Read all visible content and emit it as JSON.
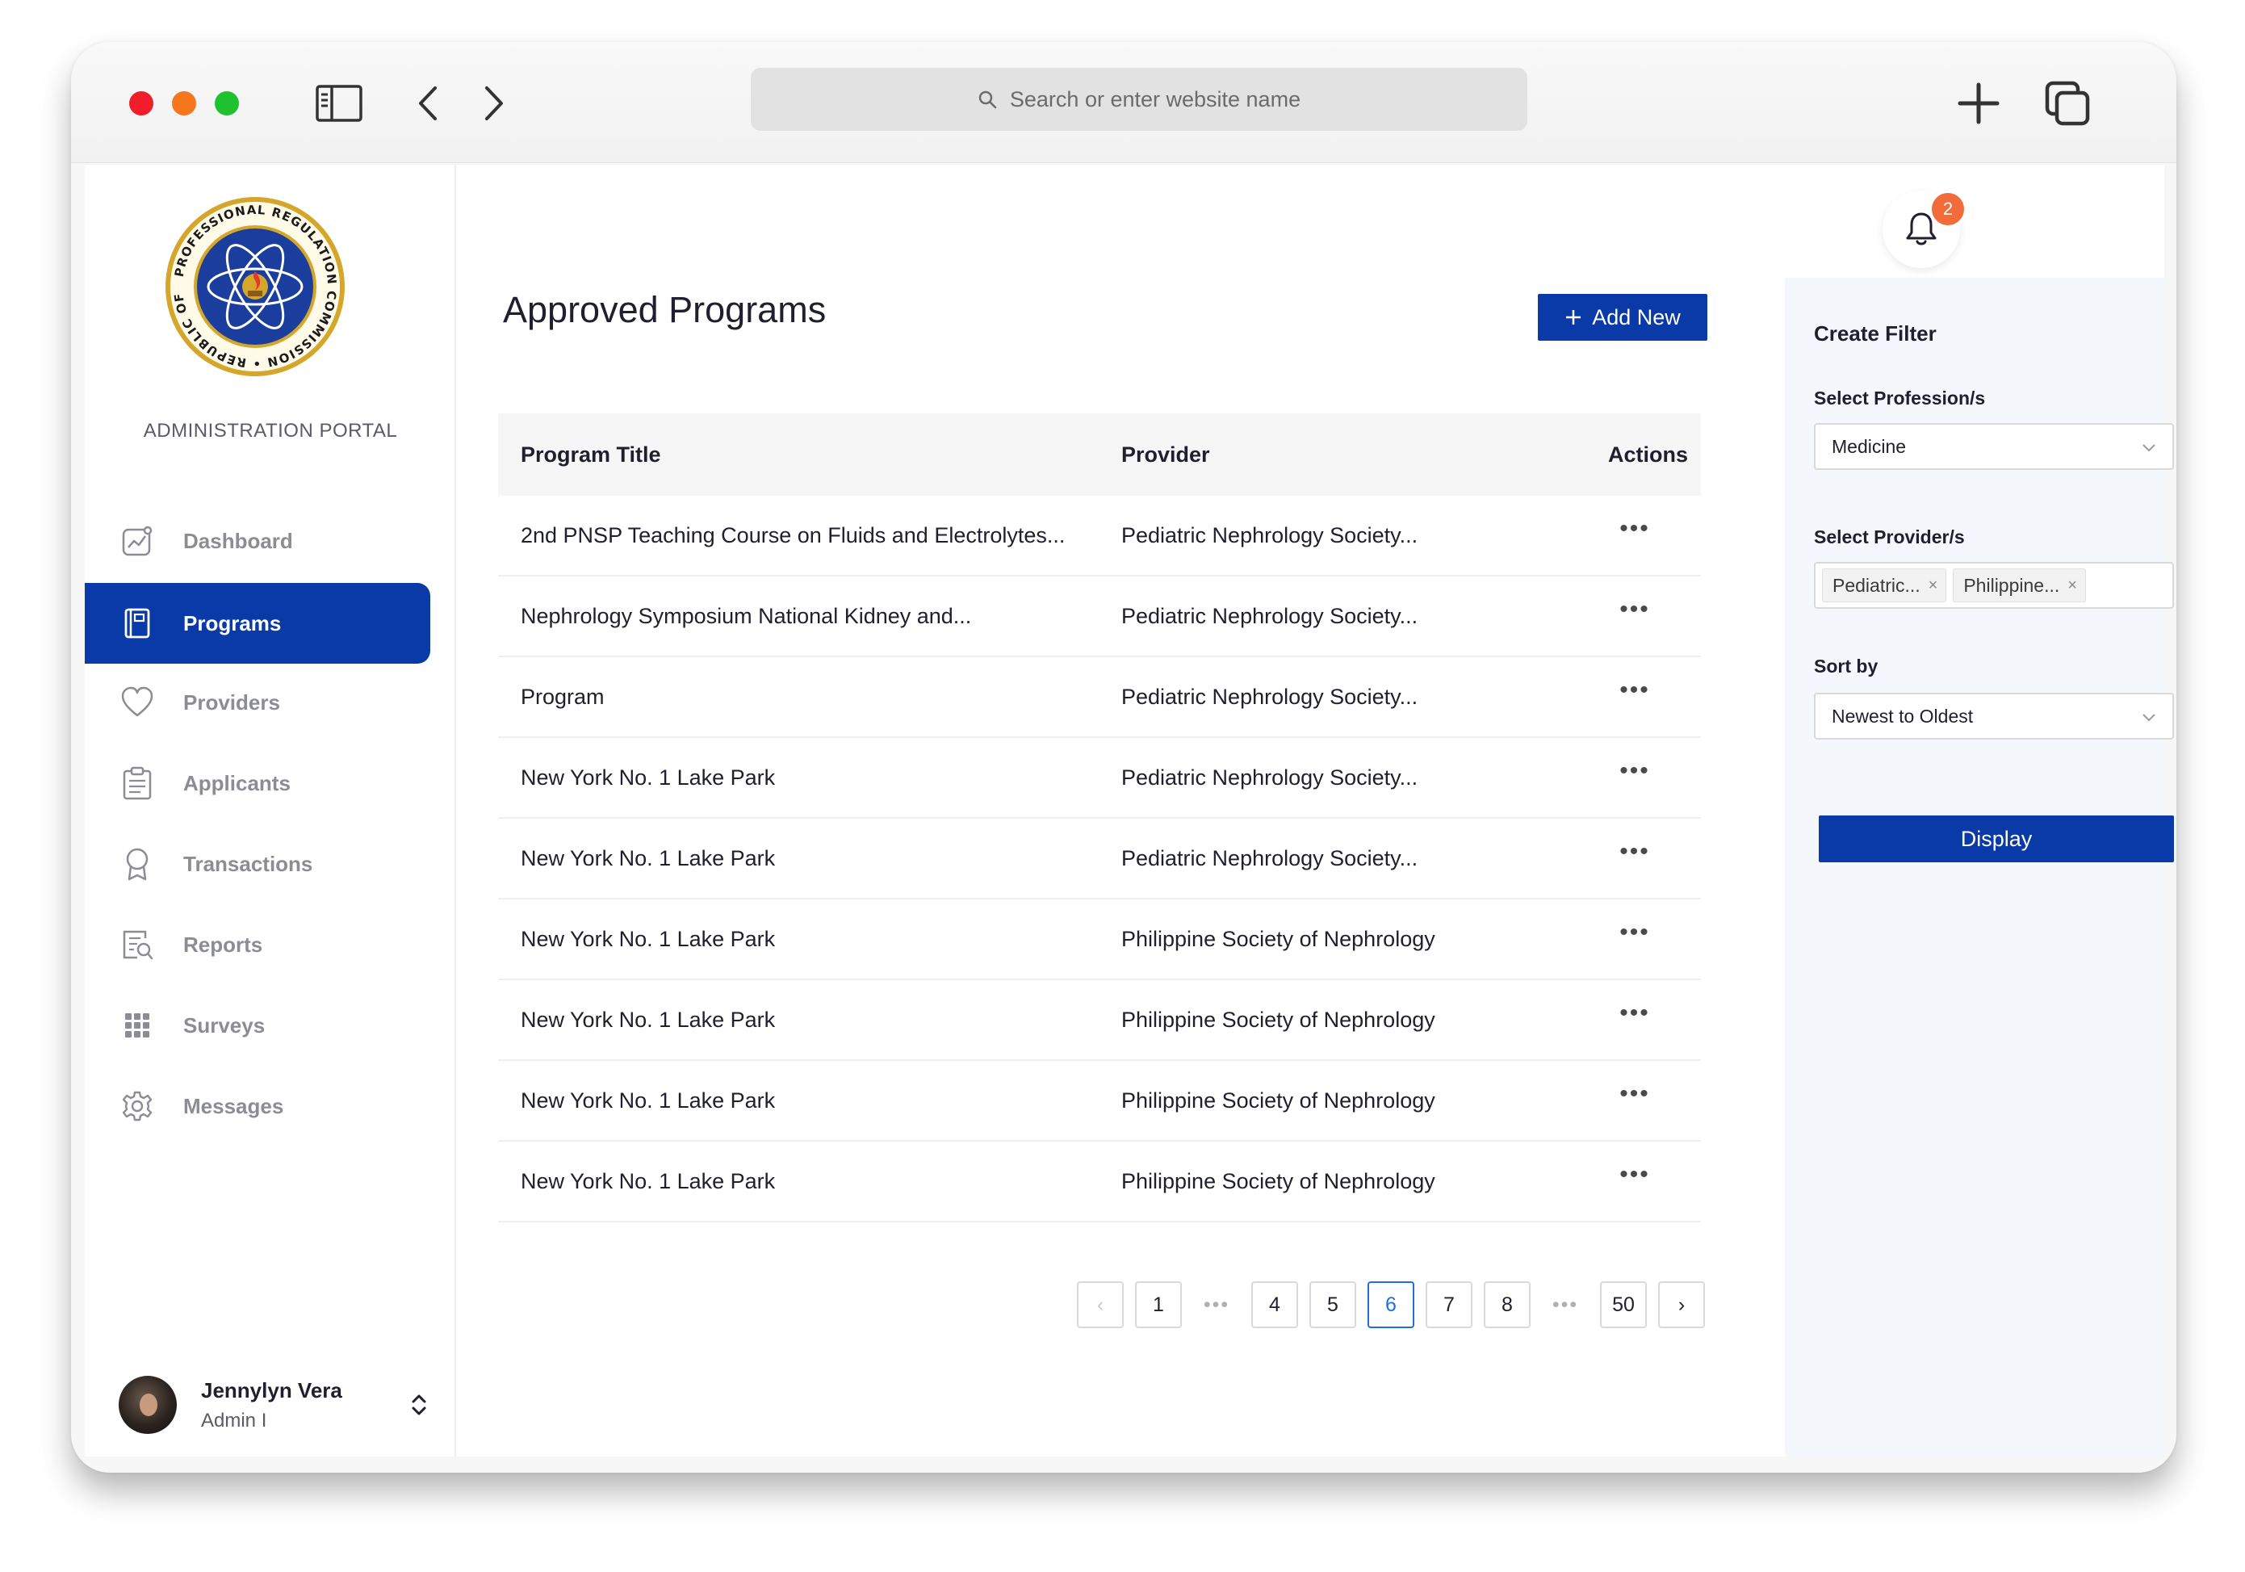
{
  "browser": {
    "url_placeholder": "Search or enter website name"
  },
  "sidebar": {
    "portal_title": "ADMINISTRATION PORTAL",
    "items": [
      {
        "label": "Dashboard",
        "icon": "chart-icon"
      },
      {
        "label": "Programs",
        "icon": "book-icon",
        "active": true
      },
      {
        "label": "Providers",
        "icon": "heart-icon"
      },
      {
        "label": "Applicants",
        "icon": "clipboard-icon"
      },
      {
        "label": "Transactions",
        "icon": "award-icon"
      },
      {
        "label": "Reports",
        "icon": "report-icon"
      },
      {
        "label": "Surveys",
        "icon": "grid-icon"
      },
      {
        "label": "Messages",
        "icon": "gear-icon"
      }
    ],
    "user": {
      "name": "Jennylyn Vera",
      "role": "Admin I"
    }
  },
  "main": {
    "title": "Approved Programs",
    "add_button": "Add New",
    "table": {
      "columns": [
        "Program Title",
        "Provider",
        "Actions"
      ],
      "rows": [
        {
          "title": "2nd PNSP Teaching Course on Fluids and Electrolytes...",
          "provider": "Pediatric Nephrology Society..."
        },
        {
          "title": "Nephrology Symposium National Kidney and...",
          "provider": "Pediatric Nephrology Society..."
        },
        {
          "title": "Program",
          "provider": "Pediatric Nephrology Society..."
        },
        {
          "title": "New York No. 1 Lake Park",
          "provider": "Pediatric Nephrology Society..."
        },
        {
          "title": "New York No. 1 Lake Park",
          "provider": "Pediatric Nephrology Society..."
        },
        {
          "title": "New York No. 1 Lake Park",
          "provider": "Philippine Society of Nephrology"
        },
        {
          "title": "New York No. 1 Lake Park",
          "provider": "Philippine Society of Nephrology"
        },
        {
          "title": "New York No. 1 Lake Park",
          "provider": "Philippine Society of Nephrology"
        },
        {
          "title": "New York No. 1 Lake Park",
          "provider": "Philippine Society of Nephrology"
        }
      ],
      "row_action": "•••"
    },
    "pagination": {
      "prev": "‹",
      "next": "›",
      "ellipsis": "•••",
      "pages": [
        "1",
        "4",
        "5",
        "6",
        "7",
        "8",
        "50"
      ],
      "current": "6"
    }
  },
  "filter": {
    "notification_count": "2",
    "title": "Create Filter",
    "profession_label": "Select Profession/s",
    "profession_value": "Medicine",
    "provider_label": "Select Provider/s",
    "provider_tags": [
      "Pediatric...",
      "Philippine..."
    ],
    "tag_remove": "×",
    "sort_label": "Sort by",
    "sort_value": "Newest to Oldest",
    "display_button": "Display"
  },
  "colors": {
    "primary": "#0a3aa8",
    "badge": "#f26b3a",
    "active_page": "#1e6fd9",
    "filter_bg": "#f4f8fc"
  }
}
